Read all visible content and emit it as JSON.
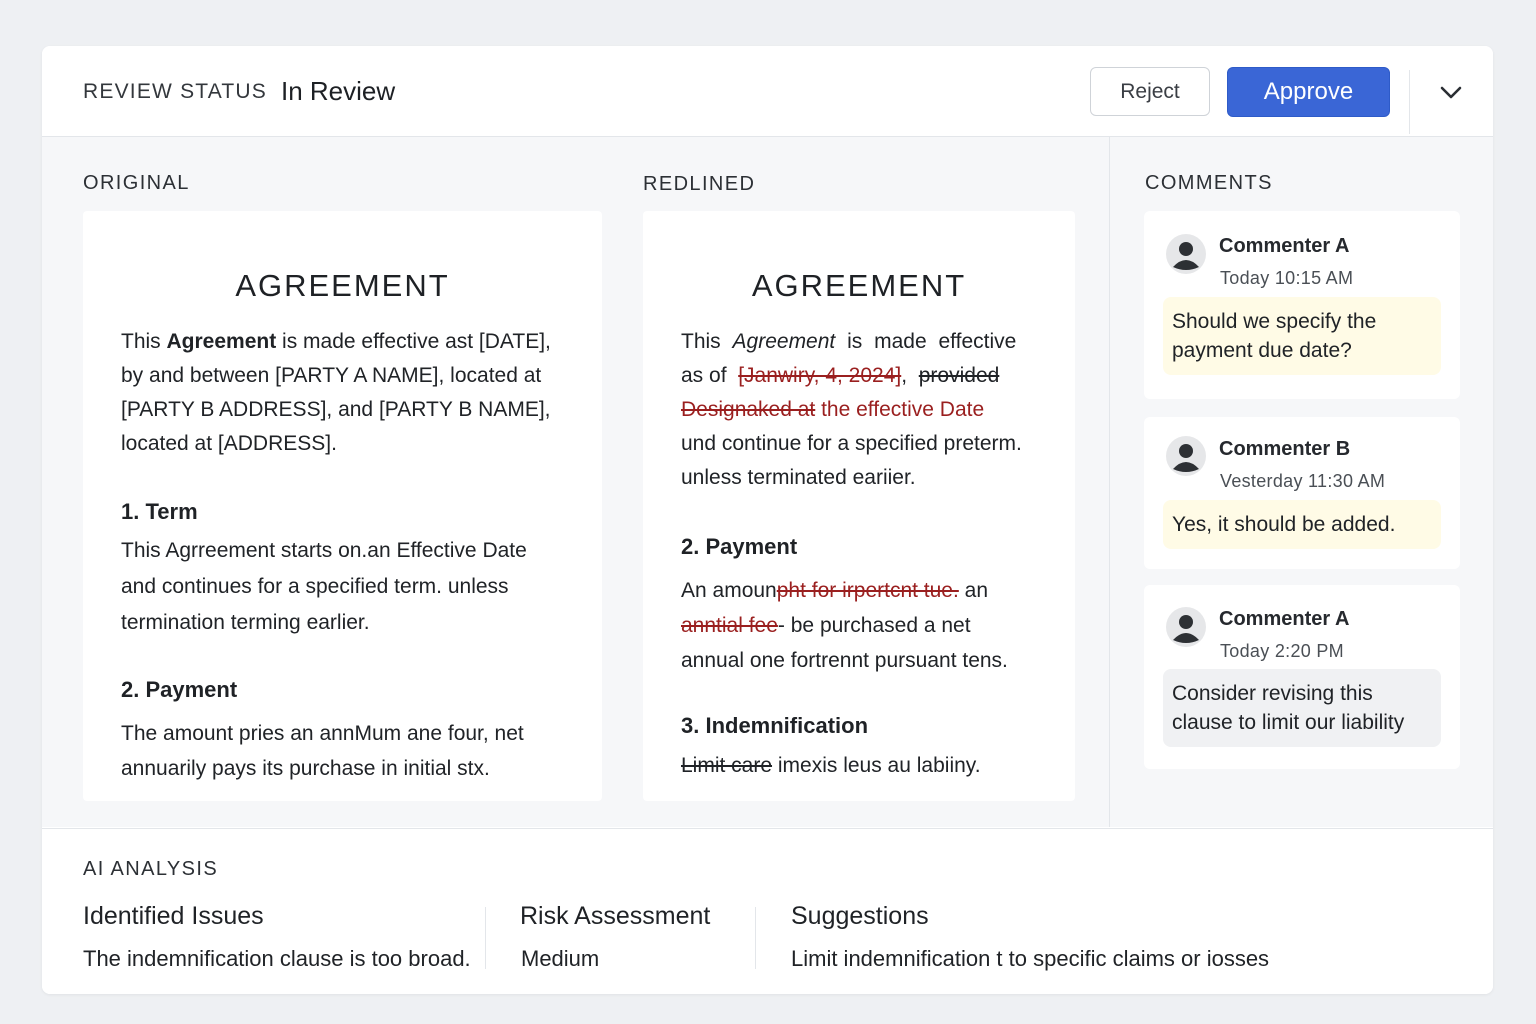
{
  "header": {
    "status_label": "REVIEW STATUS",
    "status_value": "In Review",
    "reject_label": "Reject",
    "approve_label": "Approve",
    "expand_icon": "chevron-down-icon"
  },
  "original": {
    "label": "ORIGINAL",
    "title": "AGREEMENT",
    "intro_pre": "This ",
    "intro_bold": "Agreement",
    "intro_line1_rest": " is made effective ast [DATE],",
    "intro_line2": "by and between [PARTY A NAME], located at",
    "intro_line3": "[PARTY B ADDRESS], and [PARTY B NAME],",
    "intro_line4": "located at [ADDRESS].",
    "term_heading": "1. Term",
    "term_line1": "This Agrreement starts on.an Effective Date",
    "term_line2": "and continues for a specified term. unless",
    "term_line3": "termination terming earlier.",
    "payment_heading": "2. Payment",
    "payment_line1": "The amount pries an annMum ane  four, net",
    "payment_line2": "annuarily pays its purchase in initial stx."
  },
  "redlined": {
    "label": "REDLINED",
    "title": "AGREEMENT",
    "p1_this": "This",
    "p1_agreement": "Agreement",
    "p1_rest": "is made effective",
    "p2_asof": "as of",
    "p2_deleted_date": "[Janwiry, 4, 2024]",
    "p2_comma": ",",
    "p2_deleted_provided": "provided",
    "p3_deleted": "Designaked at",
    "p3_inserted": " the effective Date",
    "p4": "und continue for a specified preterm.",
    "p5": "unless terminated eariier.",
    "payment_heading": "2. Payment",
    "pay1_a": "An amoun",
    "pay1_deleted": "pht  for irpertcnt tue.",
    "pay1_b": " an",
    "pay2_deleted": "anntial fee",
    "pay2_rest": "- be purchased a net",
    "pay3": "annual one fortrennt pursuant tens.",
    "indem_heading": "3. Indemnification",
    "indem_deleted": "Limit care",
    "indem_rest": " imexis leus au labiiny."
  },
  "comments": {
    "label": "COMMENTS",
    "items": [
      {
        "author": "Commenter A",
        "time": "Today 10:15 AM",
        "text": "Should we specify the payment due date?",
        "style": "yellow"
      },
      {
        "author": "Commenter B",
        "time": "Vesterday 11:30 AM",
        "text": "Yes, it should be added.",
        "style": "yellow"
      },
      {
        "author": "Commenter A",
        "time": "Today 2:20 PM",
        "text": "Consider revising this clause to limit our liability",
        "style": "grey"
      }
    ]
  },
  "ai_analysis": {
    "label": "AI ANALYSIS",
    "issues_title": "Identified Issues",
    "issues_text": "The indemnification clause is too broad.",
    "risk_title": "Risk Assessment",
    "risk_text": "Medium",
    "suggestions_title": "Suggestions",
    "suggestions_text": "Limit indemnification t to  specific claims or iosses"
  },
  "colors": {
    "accent": "#3a66d6",
    "deletion": "#9a1f1f",
    "comment_bubble": "#fffbe6"
  }
}
